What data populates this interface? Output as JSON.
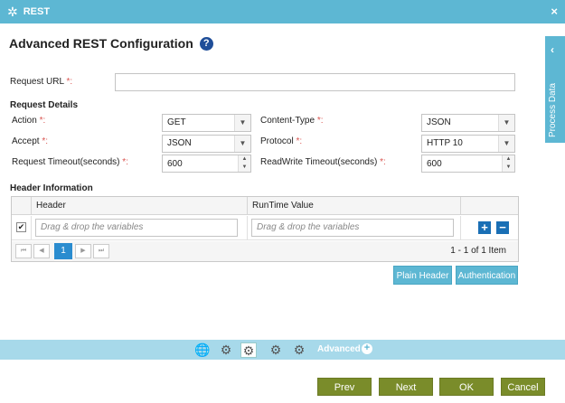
{
  "window": {
    "title": "REST",
    "close": "×"
  },
  "page": {
    "heading": "Advanced REST Configuration",
    "help": "?"
  },
  "request_url": {
    "label": "Request URL",
    "required": "*:",
    "value": ""
  },
  "request_details": {
    "section_title": "Request Details",
    "action": {
      "label": "Action",
      "required": "*:",
      "value": "GET"
    },
    "content_type": {
      "label": "Content-Type",
      "required": "*:",
      "value": "JSON"
    },
    "accept": {
      "label": "Accept",
      "required": "*:",
      "value": "JSON"
    },
    "protocol": {
      "label": "Protocol",
      "required": "*:",
      "value": "HTTP 10"
    },
    "request_timeout": {
      "label": "Request Timeout(seconds)",
      "required": "*:",
      "value": "600"
    },
    "readwrite_timeout": {
      "label": "ReadWrite Timeout(seconds)",
      "required": "*:",
      "value": "600"
    }
  },
  "header_info": {
    "section_title": "Header Information",
    "columns": [
      "Header",
      "RunTime Value"
    ],
    "rows": [
      {
        "checked": "✔",
        "header_placeholder": "Drag & drop the variables",
        "runtime_placeholder": "Drag & drop the variables"
      }
    ],
    "pager": {
      "first": "⏮",
      "prev": "◀",
      "current": "1",
      "next": "▶",
      "last": "⏭",
      "info": "1 - 1 of 1 Item"
    }
  },
  "buttons": {
    "plain_header": "Plain Header",
    "authentication": "Authentication"
  },
  "side_panel": {
    "label": "Process Data",
    "chevron": "‹"
  },
  "toolbar": {
    "advanced_label": "Advanced",
    "advanced_plus": "+"
  },
  "footer": {
    "prev": "Prev",
    "next": "Next",
    "ok": "OK",
    "cancel": "Cancel"
  },
  "colors": {
    "accent": "#5db7d3",
    "footer_button": "#7a8c2a",
    "primary_icon": "#1a6fb5",
    "required": "#d9534f"
  }
}
